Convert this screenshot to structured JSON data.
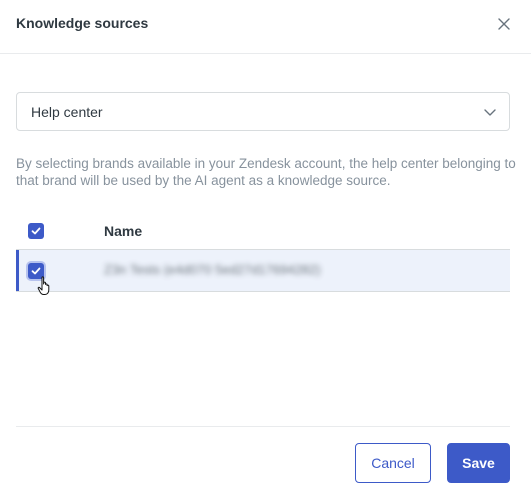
{
  "dialog": {
    "title": "Knowledge sources"
  },
  "source_select": {
    "value": "Help center"
  },
  "description": "By selecting brands available in your Zendesk account, the help center belonging to that brand will be used by the AI agent as a knowledge source.",
  "table": {
    "header": {
      "name_label": "Name",
      "all_checked": true
    },
    "rows": [
      {
        "name": "Z3n Tests (e4d070 5ed27d17694282)",
        "checked": true
      }
    ]
  },
  "footer": {
    "cancel_label": "Cancel",
    "save_label": "Save"
  },
  "colors": {
    "accent": "#3d5ac8",
    "row_highlight": "#edf2fb",
    "text": "#2f3941",
    "muted": "#87929d"
  },
  "icons": [
    "close-icon",
    "chevron-down-icon",
    "checkmark-icon",
    "hand-cursor-icon"
  ]
}
